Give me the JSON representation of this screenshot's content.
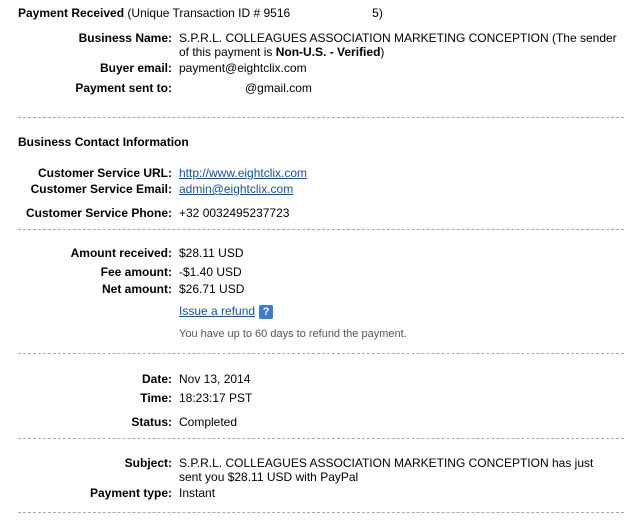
{
  "header": {
    "title": "Payment Received",
    "transaction_prefix": "(Unique Transaction ID # 9516",
    "transaction_suffix": "5)"
  },
  "details": {
    "business_name_label": "Business Name:",
    "business_name_line1": "S.P.R.L. COLLEAGUES ASSOCIATION MARKETING CONCEPTION (The sender",
    "business_name_line2_prefix": "of this payment is ",
    "business_name_line2_bold": "Non-U.S. - Verified",
    "business_name_line2_suffix": ")",
    "buyer_email_label": "Buyer email:",
    "buyer_email": "payment@eightclix.com",
    "payment_sent_to_label": "Payment sent to:",
    "payment_sent_to": "@gmail.com"
  },
  "contact": {
    "section_title": "Business Contact Information",
    "url_label": "Customer Service URL:",
    "url": "http://www.eightclix.com",
    "email_label": "Customer Service Email:",
    "email": "admin@eightclix.com",
    "phone_label": "Customer Service Phone:",
    "phone": "+32 0032495237723"
  },
  "amounts": {
    "received_label": "Amount received:",
    "received": "$28.11 USD",
    "fee_label": "Fee amount:",
    "fee": "-$1.40 USD",
    "net_label": "Net amount:",
    "net": "$26.71 USD",
    "refund_link": "Issue a refund",
    "help_icon": "?",
    "refund_note": "You have up to 60 days to refund the payment."
  },
  "status": {
    "date_label": "Date:",
    "date": "Nov 13, 2014",
    "time_label": "Time:",
    "time": "18:23:17 PST",
    "status_label": "Status:",
    "status": "Completed"
  },
  "summary": {
    "subject_label": "Subject:",
    "subject_line1": "S.P.R.L. COLLEAGUES ASSOCIATION MARKETING CONCEPTION has just",
    "subject_line2": "sent you $28.11 USD with PayPal",
    "payment_type_label": "Payment type:",
    "payment_type": "Instant"
  }
}
